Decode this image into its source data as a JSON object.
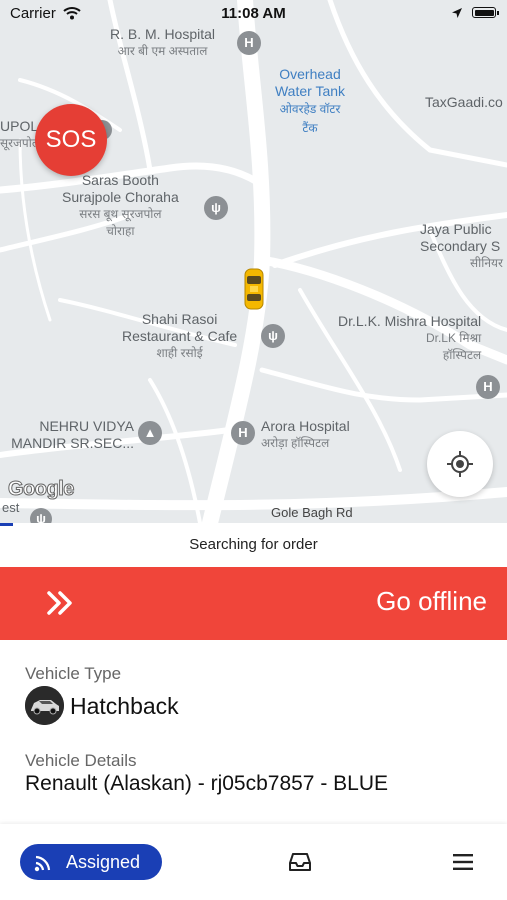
{
  "status_bar": {
    "carrier": "Carrier",
    "time": "11:08 AM"
  },
  "map": {
    "pois": [
      {
        "id": "rbm",
        "name": "R. B. M. Hospital",
        "sub": "आर बी एम अस्पताल",
        "color": "grey"
      },
      {
        "id": "tank",
        "name": "Overhead Water Tank",
        "line1": "Overhead",
        "line2": "Water Tank",
        "sub": "ओवरहेड वॉटर टैंक",
        "color": "blue"
      },
      {
        "id": "taxgaadi",
        "name": "TaxGaadi.co",
        "color": "grey"
      },
      {
        "id": "upol",
        "name": "UPOL",
        "sub": "सूरजपोल",
        "color": "grey"
      },
      {
        "id": "saras",
        "line1": "Saras Booth",
        "line2": "Surajpole Choraha",
        "sub": "सरस बूथ सूरजपोल",
        "sub2": "चोराहा",
        "color": "grey"
      },
      {
        "id": "jaya",
        "line1": "Jaya Public",
        "line2": "Secondary S",
        "sub": "सीनियर",
        "color": "grey"
      },
      {
        "id": "shahi",
        "line1": "Shahi Rasoi",
        "line2": "Restaurant & Cafe",
        "sub": "शाही रसोई",
        "color": "grey"
      },
      {
        "id": "mishra",
        "name": "Dr.L.K. Mishra Hospital",
        "sub": "Dr.LK मिश्रा",
        "sub2": "हॉस्पिटल",
        "color": "grey"
      },
      {
        "id": "nehru",
        "line1": "NEHRU VIDYA",
        "line2": "MANDIR SR.SEC...",
        "color": "grey"
      },
      {
        "id": "arora",
        "name": "Arora Hospital",
        "sub": "अरोड़ा हॉस्पिटल",
        "color": "grey"
      }
    ],
    "road_label": "Gole Bagh Rd",
    "google_logo": "Google",
    "edge_label": "est",
    "bg_color": "#e7eaec"
  },
  "sos_label": "SOS",
  "status_text": "Searching for order",
  "progress_fraction": 0.025,
  "offline_button": {
    "label": "Go offline",
    "color": "#f0453a"
  },
  "vehicle": {
    "type_label": "Vehicle Type",
    "type_value": "Hatchback",
    "details_label": "Vehicle Details",
    "details_value": "Renault (Alaskan) - rj05cb7857 - BLUE"
  },
  "nav": {
    "assigned_label": "Assigned",
    "accent": "#1a3fb5"
  },
  "icons": [
    "wifi-icon",
    "location-arrow-icon",
    "battery-icon",
    "hospital-icon",
    "restaurant-icon",
    "school-icon",
    "taxi-icon",
    "recenter-icon",
    "chevron-double-right-icon",
    "broadcast-icon",
    "inbox-icon",
    "menu-icon"
  ]
}
